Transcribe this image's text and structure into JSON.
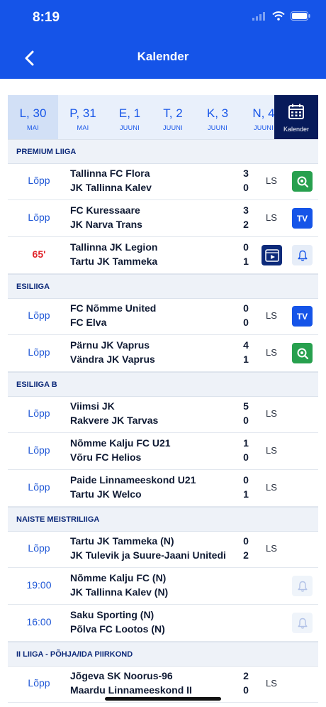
{
  "status_bar": {
    "time": "8:19"
  },
  "header": {
    "title": "Kalender"
  },
  "dates": [
    {
      "day": "L, 30",
      "month": "MAI"
    },
    {
      "day": "P, 31",
      "month": "MAI"
    },
    {
      "day": "E, 1",
      "month": "JUUNI"
    },
    {
      "day": "T, 2",
      "month": "JUUNI"
    },
    {
      "day": "K, 3",
      "month": "JUUNI"
    },
    {
      "day": "N, 4",
      "month": "JUUNI"
    }
  ],
  "calendar_button": {
    "label": "Kalender"
  },
  "sections": [
    {
      "title": "PREMIUM LIIGA"
    },
    {
      "title": "ESILIIGA"
    },
    {
      "title": "ESILIIGA B"
    },
    {
      "title": "NAISTE MEISTRILIIGA"
    },
    {
      "title": "II LIIGA - PÕHJA/IDA PIIRKOND"
    }
  ],
  "matches": [
    {
      "status": "Lõpp",
      "home": "Tallinna FC Flora",
      "away": "JK Tallinna Kalev",
      "home_score": "3",
      "away_score": "0",
      "ls": "LS"
    },
    {
      "status": "Lõpp",
      "home": "FC Kuressaare",
      "away": "JK Narva Trans",
      "home_score": "3",
      "away_score": "2",
      "ls": "LS",
      "tv": "TV"
    },
    {
      "status": "65'",
      "home": "Tallinna JK Legion",
      "away": "Tartu JK Tammeka",
      "home_score": "0",
      "away_score": "1"
    },
    {
      "status": "Lõpp",
      "home": "FC Nõmme United",
      "away": "FC Elva",
      "home_score": "0",
      "away_score": "0",
      "ls": "LS",
      "tv": "TV"
    },
    {
      "status": "Lõpp",
      "home": "Pärnu JK Vaprus",
      "away": "Vändra JK Vaprus",
      "home_score": "4",
      "away_score": "1",
      "ls": "LS"
    },
    {
      "status": "Lõpp",
      "home": "Viimsi JK",
      "away": "Rakvere JK Tarvas",
      "home_score": "5",
      "away_score": "0",
      "ls": "LS"
    },
    {
      "status": "Lõpp",
      "home": "Nõmme Kalju FC U21",
      "away": "Võru FC Helios",
      "home_score": "1",
      "away_score": "0",
      "ls": "LS"
    },
    {
      "status": "Lõpp",
      "home": "Paide Linnameeskond U21",
      "away": "Tartu JK Welco",
      "home_score": "0",
      "away_score": "1",
      "ls": "LS"
    },
    {
      "status": "Lõpp",
      "home": "Tartu JK Tammeka (N)",
      "away": "JK Tulevik ja Suure-Jaani Unitedi",
      "home_score": "0",
      "away_score": "2",
      "ls": "LS"
    },
    {
      "status": "19:00",
      "home": "Nõmme Kalju FC (N)",
      "away": "JK Tallinna Kalev (N)"
    },
    {
      "status": "16:00",
      "home": "Saku Sporting (N)",
      "away": "Põlva FC Lootos (N)"
    },
    {
      "status": "Lõpp",
      "home": "Jõgeva SK Noorus-96",
      "away": "Maardu Linnameeskond II",
      "home_score": "2",
      "away_score": "0",
      "ls": "LS"
    }
  ],
  "colors": {
    "brand_blue": "#1554e8",
    "navy": "#071a5a",
    "live_red": "#e0242a",
    "stream_green": "#27a04e"
  }
}
